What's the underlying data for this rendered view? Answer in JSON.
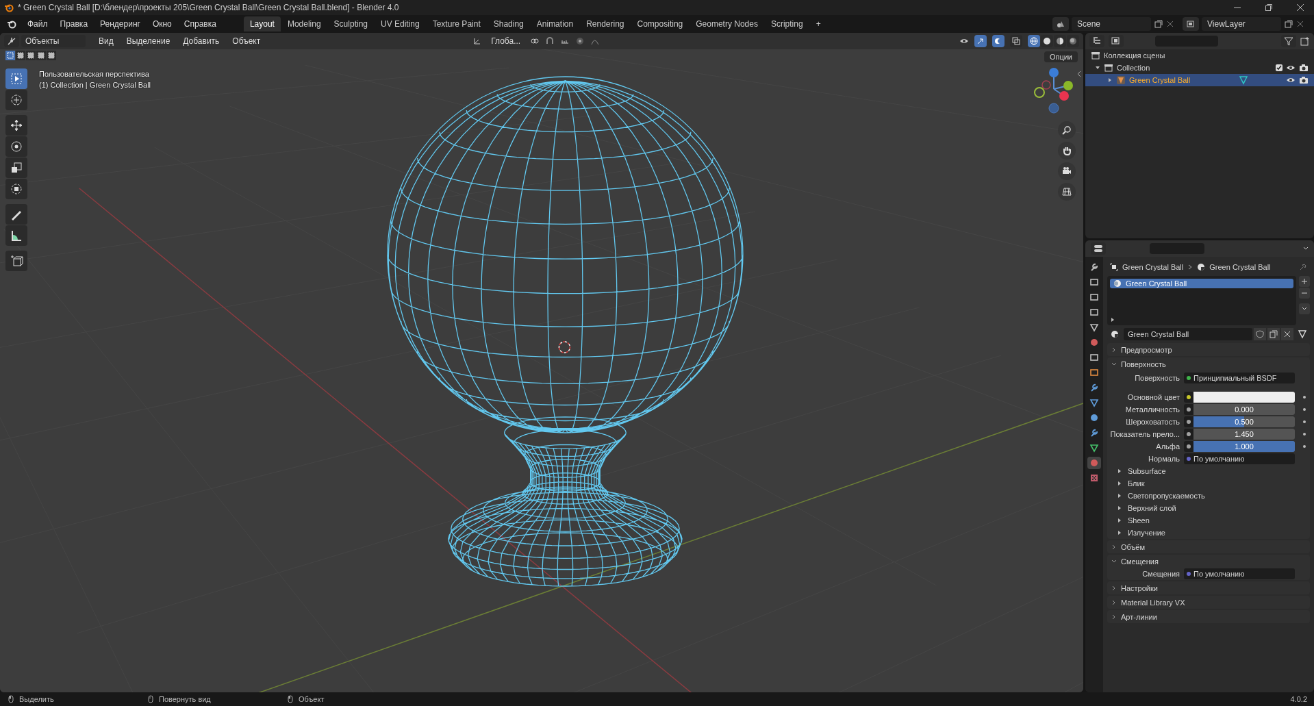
{
  "window": {
    "title": "* Green Crystal Ball [D:\\блендер\\проекты 205\\Green Crystal Ball\\Green Crystal Ball.blend] - Blender 4.0"
  },
  "menu": [
    "Файл",
    "Правка",
    "Рендеринг",
    "Окно",
    "Справка"
  ],
  "workspaces": [
    {
      "label": "Layout",
      "selected": true
    },
    {
      "label": "Modeling",
      "selected": false
    },
    {
      "label": "Sculpting",
      "selected": false
    },
    {
      "label": "UV Editing",
      "selected": false
    },
    {
      "label": "Texture Paint",
      "selected": false
    },
    {
      "label": "Shading",
      "selected": false
    },
    {
      "label": "Animation",
      "selected": false
    },
    {
      "label": "Rendering",
      "selected": false
    },
    {
      "label": "Compositing",
      "selected": false
    },
    {
      "label": "Geometry Nodes",
      "selected": false
    },
    {
      "label": "Scripting",
      "selected": false
    }
  ],
  "add_workspace": "+",
  "scene": {
    "name": "Scene"
  },
  "view_layer": {
    "name": "ViewLayer"
  },
  "viewport": {
    "mode": "Объекты",
    "menus": [
      "Вид",
      "Выделение",
      "Добавить",
      "Объект"
    ],
    "orientation": "Глоба...",
    "options": "Опции",
    "select_modes": [
      {
        "selected": true
      },
      {
        "selected": false
      },
      {
        "selected": false
      },
      {
        "selected": false
      },
      {
        "selected": false
      }
    ],
    "info_lines": [
      "Пользовательская перспектива",
      "(1) Collection | Green Crystal Ball"
    ],
    "tools": [
      {
        "kind": "select",
        "selected": true
      },
      {
        "kind": "cursor",
        "selected": false
      },
      {
        "kind": "move",
        "selected": false
      },
      {
        "kind": "rotate",
        "selected": false
      },
      {
        "kind": "scale",
        "selected": false
      },
      {
        "kind": "transform",
        "selected": false
      },
      {
        "kind": "annotate",
        "selected": false
      },
      {
        "kind": "measure",
        "selected": false
      },
      {
        "kind": "add-cube",
        "selected": false
      }
    ],
    "shading": [
      {
        "kind": "wireframe",
        "selected": true
      },
      {
        "kind": "solid",
        "selected": false
      },
      {
        "kind": "material",
        "selected": false
      },
      {
        "kind": "rendered",
        "selected": false
      }
    ]
  },
  "outliner": {
    "root": "Коллекция сцены",
    "children": [
      {
        "label": "Collection",
        "checked": true,
        "expanded": true,
        "selected": false,
        "children": [
          {
            "label": "Green Crystal Ball",
            "selected": true,
            "expanded": false
          }
        ]
      }
    ]
  },
  "properties": {
    "tabs": [
      {
        "kind": "tool",
        "selected": false
      },
      {
        "kind": "render",
        "selected": false
      },
      {
        "kind": "output",
        "selected": false
      },
      {
        "kind": "view-layer",
        "selected": false
      },
      {
        "kind": "scene",
        "selected": false
      },
      {
        "kind": "world",
        "selected": false
      },
      {
        "kind": "collection",
        "selected": false
      },
      {
        "kind": "object",
        "selected": false
      },
      {
        "kind": "modifier",
        "selected": false
      },
      {
        "kind": "particles",
        "selected": false
      },
      {
        "kind": "physics",
        "selected": false
      },
      {
        "kind": "constraints",
        "selected": false
      },
      {
        "kind": "data",
        "selected": false
      },
      {
        "kind": "material",
        "selected": true
      },
      {
        "kind": "texture",
        "selected": false
      }
    ],
    "breadcrumb": [
      "Green Crystal Ball",
      "Green Crystal Ball"
    ],
    "material_slots": [
      {
        "label": "Green Crystal Ball",
        "selected": true
      }
    ],
    "material_name": "Green Crystal Ball",
    "panels": [
      {
        "title": "Предпросмотр",
        "expanded": false
      },
      {
        "title": "Поверхность",
        "expanded": true,
        "fields": [
          {
            "kind": "shader",
            "label": "Поверхность",
            "value": "Принципиальный BSDF",
            "color": "#3fb44a"
          },
          {
            "kind": "swatch",
            "label": "Основной цвет",
            "color": "#c7c729"
          },
          {
            "kind": "slider",
            "label": "Металличность",
            "value": "0.000",
            "level": 0,
            "color": "#a1a1a1"
          },
          {
            "kind": "slider",
            "label": "Шероховатость",
            "value": "0.500",
            "level": 0.5,
            "color": "#a1a1a1"
          },
          {
            "kind": "number",
            "label": "Показатель прело...",
            "value": "1.450",
            "color": "#a1a1a1"
          },
          {
            "kind": "slider",
            "label": "Альфа",
            "value": "1.000",
            "level": 1,
            "color": "#a1a1a1"
          },
          {
            "kind": "link",
            "label": "Нормаль",
            "value": "По умолчанию",
            "color": "#6363c7"
          }
        ],
        "subpanels": [
          {
            "title": "Subsurface",
            "expanded": false
          },
          {
            "title": "Блик",
            "expanded": false
          },
          {
            "title": "Светопропускаемость",
            "expanded": false
          },
          {
            "title": "Верхний слой",
            "expanded": false
          },
          {
            "title": "Sheen",
            "expanded": false
          },
          {
            "title": "Излучение",
            "expanded": false
          }
        ]
      },
      {
        "title": "Объём",
        "expanded": false
      },
      {
        "title": "Смещения",
        "expanded": true,
        "fields": [
          {
            "kind": "link",
            "label": "Смещения",
            "value": "По умолчанию",
            "color": "#6363c7"
          }
        ]
      },
      {
        "title": "Настройки",
        "expanded": false
      },
      {
        "title": "Material Library VX",
        "expanded": false
      },
      {
        "title": "Арт-линии",
        "expanded": false
      }
    ]
  },
  "status_bar": {
    "items": [
      "Выделить",
      "Повернуть вид",
      "Объект"
    ],
    "version": "4.0.2"
  }
}
